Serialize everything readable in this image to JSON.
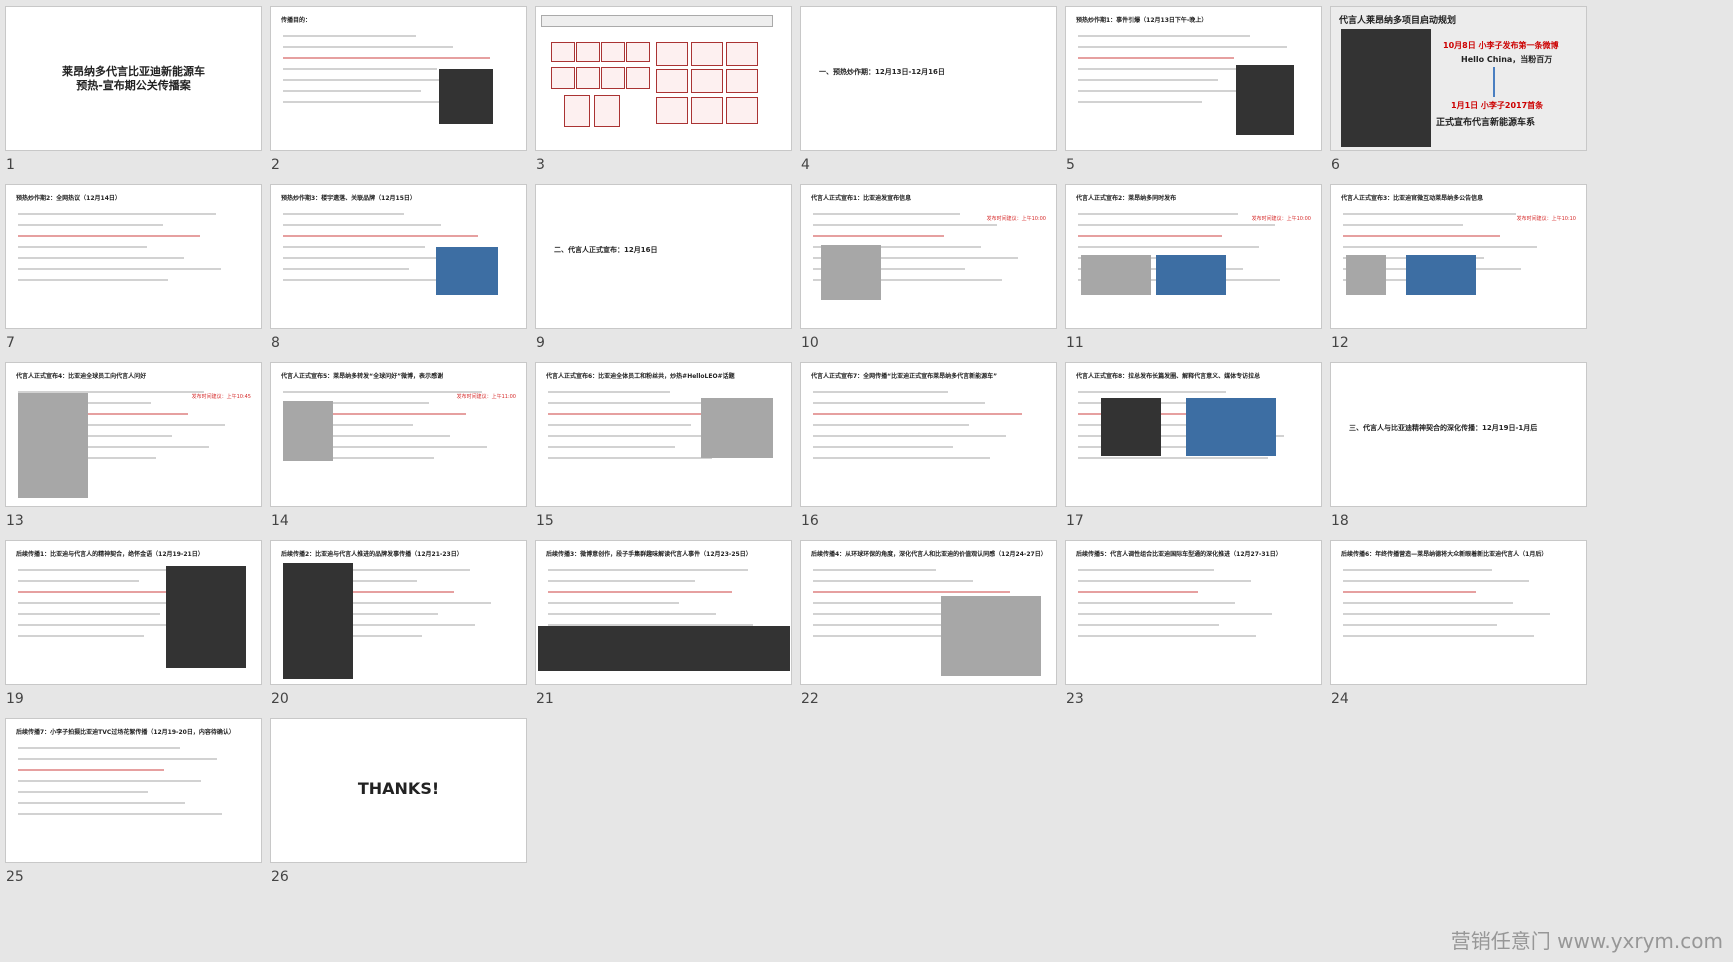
{
  "slides": [
    {
      "n": "1",
      "title": "莱昂纳多代言比亚迪新能源车\n预热-宣布期公关传播案"
    },
    {
      "n": "2",
      "title": "传播目的："
    },
    {
      "n": "3",
      "title": ""
    },
    {
      "n": "4",
      "title": "一、预热炒作期：12月13日-12月16日"
    },
    {
      "n": "5",
      "title": "预热炒作期1：事件引爆（12月13日下午-晚上）"
    },
    {
      "n": "6",
      "title": "代言人莱昂纳多项目启动规划",
      "a": "10月8日 小李子发布第一条微博",
      "b": "Hello China，当粉百万",
      "c": "1月1日 小李子2017首条",
      "d": "正式宣布代言新能源车系"
    },
    {
      "n": "7",
      "title": "预热炒作期2：全网热议（12月14日）"
    },
    {
      "n": "8",
      "title": "预热炒作期3：楼宇遗落、关联品牌（12月15日）"
    },
    {
      "n": "9",
      "title": "二、代言人正式宣布：12月16日"
    },
    {
      "n": "10",
      "title": "代言人正式宣布1：比亚迪发宣布信息",
      "time": "发布时间建议：上午10:00"
    },
    {
      "n": "11",
      "title": "代言人正式宣布2：莱昂纳多同时发布",
      "time": "发布时间建议：上午10:00"
    },
    {
      "n": "12",
      "title": "代言人正式宣布3：比亚迪官微互动莱昂纳多公告信息",
      "time": "发布时间建议：上午10:10"
    },
    {
      "n": "13",
      "title": "代言人正式宣布4：比亚迪全球员工向代言人问好",
      "time": "发布时间建议：上午10:45"
    },
    {
      "n": "14",
      "title": "代言人正式宣布5：莱昂纳多转发“全球问好”微博，表示感谢",
      "time": "发布时间建议：上午11:00"
    },
    {
      "n": "15",
      "title": "代言人正式宣布6：比亚迪全体员工和粉丝共，炒热#HelloLEO#话题"
    },
    {
      "n": "16",
      "title": "代言人正式宣布7：全网传播“比亚迪正式宣布莱昂纳多代言新能源车”"
    },
    {
      "n": "17",
      "title": "代言人正式宣布8：拉总发布长篇发圈、解释代言意义、媒体专访拉总"
    },
    {
      "n": "18",
      "title": "三、代言人与比亚迪精神契合的深化传播：12月19日-1月后"
    },
    {
      "n": "19",
      "title": "后续传播1：比亚迪与代言人的精神契合，绝怀金语（12月19-21日）"
    },
    {
      "n": "20",
      "title": "后续传播2：比亚迪与代言人推进的品牌发事传播（12月21-23日）"
    },
    {
      "n": "21",
      "title": "后续传播3：微博意创作，段子手集群趣味解读代言人事件（12月23-25日）"
    },
    {
      "n": "22",
      "title": "后续传播4：从环球环保的角度，深化代言人和比亚迪的价值观认同感（12月24-27日）"
    },
    {
      "n": "23",
      "title": "后续传播5：代言人调性组合比亚迪国际车型通的深化推进（12月27-31日）"
    },
    {
      "n": "24",
      "title": "后续传播6：年终传播营造—莱昂纳德将大众新眼着新比亚迪代言人（1月后）"
    },
    {
      "n": "25",
      "title": "后续传播7：小李子拍摄比亚迪TVC过场花絮传播（12月19-20日，内容待确认）"
    },
    {
      "n": "26",
      "title": "THANKS!"
    }
  ],
  "watermark": "营销任意门 www.yxrym.com"
}
